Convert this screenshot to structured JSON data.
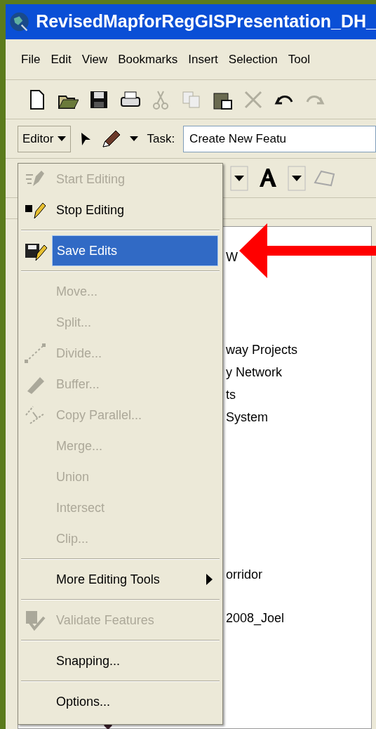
{
  "window": {
    "title": "RevisedMapforRegGISPresentation_DH_"
  },
  "menu_bar": [
    "File",
    "Edit",
    "View",
    "Bookmarks",
    "Insert",
    "Selection",
    "Tool"
  ],
  "standard_toolbar": [
    {
      "disabled": false
    },
    {
      "disabled": false
    },
    {
      "disabled": false
    },
    {
      "disabled": false
    },
    {
      "disabled": true
    },
    {
      "disabled": true
    },
    {
      "disabled": false
    },
    {
      "disabled": true
    },
    {
      "disabled": false
    },
    {
      "disabled": true
    }
  ],
  "editor_toolbar": {
    "editor_menu": "Editor",
    "task_label": "Task:",
    "task_value": "Create New Featu"
  },
  "editor_menu": [
    {
      "kind": "command",
      "label": "Start Editing",
      "disabled": true,
      "selected": false
    },
    {
      "kind": "command",
      "label": "Stop Editing",
      "disabled": false,
      "selected": false
    },
    {
      "kind": "separator"
    },
    {
      "kind": "command",
      "label": "Save Edits",
      "disabled": false,
      "selected": true
    },
    {
      "kind": "separator"
    },
    {
      "kind": "command",
      "label": "Move...",
      "disabled": true,
      "selected": false
    },
    {
      "kind": "command",
      "label": "Split...",
      "disabled": true,
      "selected": false
    },
    {
      "kind": "command",
      "label": "Divide...",
      "disabled": true,
      "selected": false
    },
    {
      "kind": "command",
      "label": "Buffer...",
      "disabled": true,
      "selected": false
    },
    {
      "kind": "command",
      "label": "Copy Parallel...",
      "disabled": true,
      "selected": false
    },
    {
      "kind": "command",
      "label": "Merge...",
      "disabled": true,
      "selected": false
    },
    {
      "kind": "command",
      "label": "Union",
      "disabled": true,
      "selected": false
    },
    {
      "kind": "command",
      "label": "Intersect",
      "disabled": true,
      "selected": false
    },
    {
      "kind": "command",
      "label": "Clip...",
      "disabled": true,
      "selected": false
    },
    {
      "kind": "separator"
    },
    {
      "kind": "submenu",
      "label": "More Editing Tools",
      "disabled": false,
      "selected": false
    },
    {
      "kind": "separator"
    },
    {
      "kind": "command",
      "label": "Validate Features",
      "disabled": true,
      "selected": false
    },
    {
      "kind": "separator"
    },
    {
      "kind": "command",
      "label": "Snapping...",
      "disabled": false,
      "selected": false
    },
    {
      "kind": "separator"
    },
    {
      "kind": "command",
      "label": "Options...",
      "disabled": false,
      "selected": false
    }
  ],
  "table_of_contents": [
    "W",
    "way Projects",
    "y Network",
    "ts",
    "System",
    "orridor",
    "2008_Joel"
  ]
}
